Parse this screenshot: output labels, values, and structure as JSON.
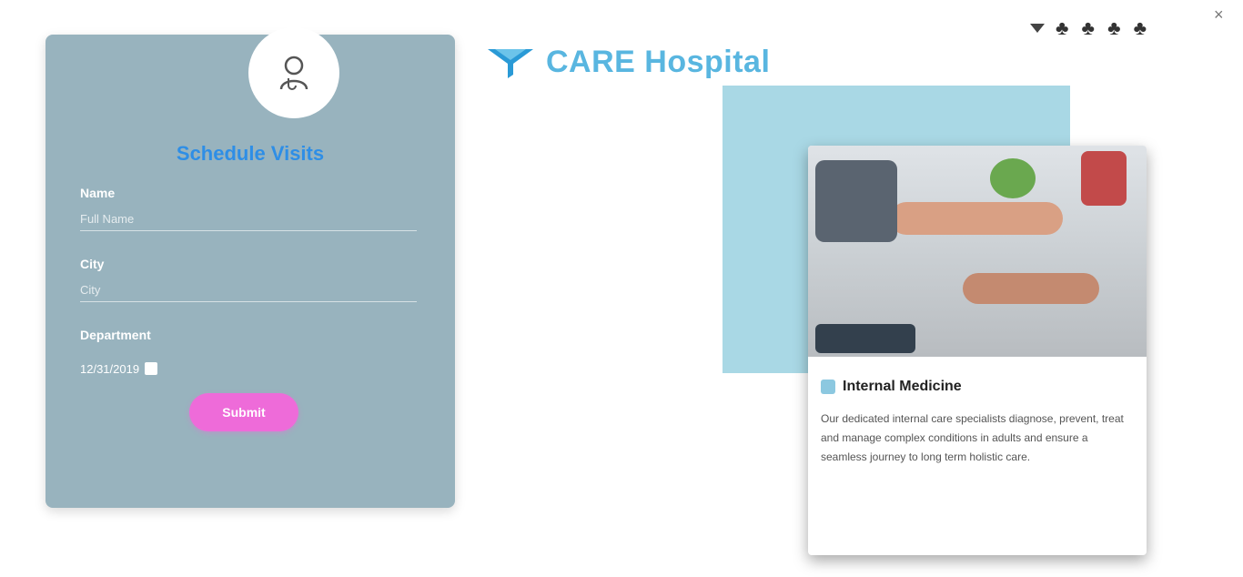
{
  "form": {
    "title": "Schedule Visits",
    "name_label": "Name",
    "name_placeholder": "Full Name",
    "city_label": "City",
    "city_placeholder": "City",
    "date_label": "Department",
    "date_value": "12/31/2019",
    "submit_label": "Submit"
  },
  "logo": {
    "name": "CARE Hospital",
    "color": "#59b6e0"
  },
  "header": {
    "social_icons": "♣ ♣ ♣ ♣",
    "close": "×"
  },
  "card": {
    "title": "Internal Medicine",
    "body": "Our dedicated internal care specialists diagnose, prevent, treat and manage complex conditions in adults and ensure a seamless journey to long term holistic care."
  },
  "colors": {
    "form_bg": "#98b3be",
    "form_title": "#2e8ee6",
    "submit_bg": "#ee6bd9",
    "blue_panel": "#a9d8e5"
  }
}
